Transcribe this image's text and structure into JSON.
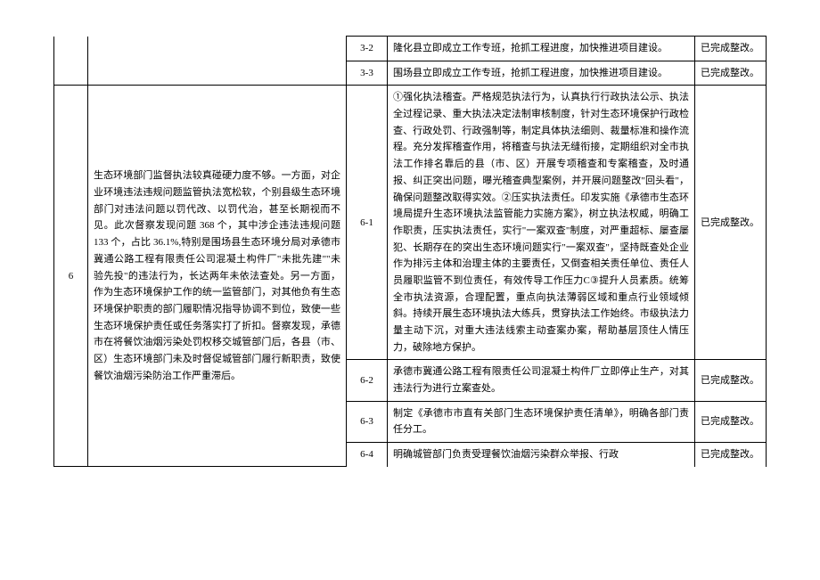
{
  "rows": [
    {
      "num": "",
      "desc": "",
      "sub": [
        {
          "id": "3-2",
          "action": "隆化县立即成立工作专班，抢抓工程进度，加快推进项目建设。",
          "status": "已完成整改。"
        },
        {
          "id": "3-3",
          "action": "围场县立即成立工作专班，抢抓工程进度，加快推进项目建设。",
          "status": "已完成整改。"
        }
      ]
    },
    {
      "num": "6",
      "desc": "生态环境部门监督执法较真碰硬力度不够。一方面，对企业环境违法违规问题监管执法宽松软，个别县级生态环境部门对违法问题以罚代改、以罚代治，甚至长期视而不见。此次督察发现问题 368 个，其中涉企违法违规问题 133 个，占比 36.1%,特别是围场县生态环境分局对承德市冀通公路工程有限责任公司混凝土构件厂\"未批先建\"\"未验先投\"的违法行为，长达两年未依法查处。另一方面，作为生态环境保护工作的统一监管部门，对其他负有生态环境保护职责的部门履职情况指导协调不到位，致使一些生态环境保护责任或任务落实打了折扣。督察发现，承德市在将餐饮油烟污染处罚权移交城管部门后，各县（市、区）生态环境部门未及时督促城管部门履行新职责，致使餐饮油烟污染防治工作严重滞后。",
      "sub": [
        {
          "id": "6-1",
          "action": "①强化执法稽查。严格规范执法行为，认真执行行政执法公示、执法全过程记录、重大执法决定法制审核制度，针对生态环境保护行政检查、行政处罚、行政强制等，制定具体执法细则、裁量标准和操作流程。充分发挥稽查作用，将稽查与执法无缝衔接，定期组织对全市执法工作排名靠后的县（市、区）开展专项稽查和专案稽查，及时通报、纠正突出问题，曝光稽查典型案例，并开展问题整改\"回头看\"，确保问题整改取得实效。②压实执法责任。印发实施《承德市生态环境局提升生态环境执法监管能力实施方案》，树立执法权威，明确工作职责，压实执法责任，实行\"一案双查\"制度，对严重超标、屡查屡犯、长期存在的突出生态环境问题实行\"一案双查\"，坚持既查处企业作为排污主体和治理主体的主要责任，又倒查相关责任单位、责任人员履职监管不到位责任，有效传导工作压力C③提升人员素质。统筹全市执法资源，合理配置，重点向执法薄弱区域和重点行业领域倾斜。持续开展生态环境执法大练兵，贯穿执法工作始终。市级执法力量主动下沉，对重大违法线索主动查案办案，帮助基层顶住人情压力，破除地方保护。",
          "status": "已完成整改。"
        },
        {
          "id": "6-2",
          "action": "承德市冀通公路工程有限责任公司混凝土构件厂立即停止生产，对其违法行为进行立案查处。",
          "status": "已完成整改。"
        },
        {
          "id": "6-3",
          "action": "制定《承德市市直有关部门生态环境保护责任清单》，明确各部门责任分工。",
          "status": "已完成整改。"
        },
        {
          "id": "6-4",
          "action": "明确城管部门负责受理餐饮油烟污染群众举报、行政",
          "status": "已完成整改。"
        }
      ]
    }
  ]
}
